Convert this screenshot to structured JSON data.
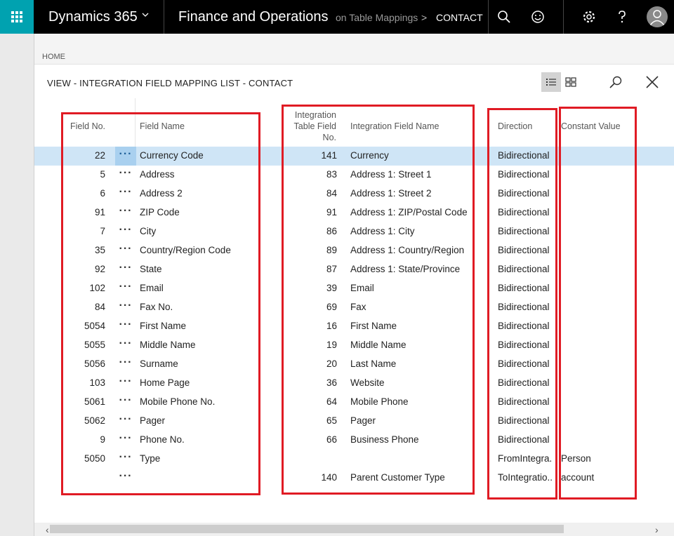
{
  "topbar": {
    "brand": "Dynamics 365",
    "app_name": "Finance and Operations",
    "breadcrumb_prev": "on Table Mappings",
    "breadcrumb_sep": ">",
    "breadcrumb_current": "CONTACT"
  },
  "home_label": "HOME",
  "page_title": "VIEW - INTEGRATION FIELD MAPPING LIST - CONTACT",
  "columns": {
    "field_no": "Field No.",
    "field_name": "Field Name",
    "int_field_no_1": "Integration",
    "int_field_no_2": "Table Field",
    "int_field_no_3": "No.",
    "int_field_name": "Integration Field Name",
    "direction": "Direction",
    "constant_value": "Constant Value"
  },
  "rows": [
    {
      "field_no": "22",
      "field_name": "Currency Code",
      "int_no": "141",
      "int_name": "Currency",
      "direction": "Bidirectional",
      "constant": ""
    },
    {
      "field_no": "5",
      "field_name": "Address",
      "int_no": "83",
      "int_name": "Address 1: Street 1",
      "direction": "Bidirectional",
      "constant": ""
    },
    {
      "field_no": "6",
      "field_name": "Address 2",
      "int_no": "84",
      "int_name": "Address 1: Street 2",
      "direction": "Bidirectional",
      "constant": ""
    },
    {
      "field_no": "91",
      "field_name": "ZIP Code",
      "int_no": "91",
      "int_name": "Address 1: ZIP/Postal Code",
      "direction": "Bidirectional",
      "constant": ""
    },
    {
      "field_no": "7",
      "field_name": "City",
      "int_no": "86",
      "int_name": "Address 1: City",
      "direction": "Bidirectional",
      "constant": ""
    },
    {
      "field_no": "35",
      "field_name": "Country/Region Code",
      "int_no": "89",
      "int_name": "Address 1: Country/Region",
      "direction": "Bidirectional",
      "constant": ""
    },
    {
      "field_no": "92",
      "field_name": "State",
      "int_no": "87",
      "int_name": "Address 1: State/Province",
      "direction": "Bidirectional",
      "constant": ""
    },
    {
      "field_no": "102",
      "field_name": "Email",
      "int_no": "39",
      "int_name": "Email",
      "direction": "Bidirectional",
      "constant": ""
    },
    {
      "field_no": "84",
      "field_name": "Fax No.",
      "int_no": "69",
      "int_name": "Fax",
      "direction": "Bidirectional",
      "constant": ""
    },
    {
      "field_no": "5054",
      "field_name": "First Name",
      "int_no": "16",
      "int_name": "First Name",
      "direction": "Bidirectional",
      "constant": ""
    },
    {
      "field_no": "5055",
      "field_name": "Middle Name",
      "int_no": "19",
      "int_name": "Middle Name",
      "direction": "Bidirectional",
      "constant": ""
    },
    {
      "field_no": "5056",
      "field_name": "Surname",
      "int_no": "20",
      "int_name": "Last Name",
      "direction": "Bidirectional",
      "constant": ""
    },
    {
      "field_no": "103",
      "field_name": "Home Page",
      "int_no": "36",
      "int_name": "Website",
      "direction": "Bidirectional",
      "constant": ""
    },
    {
      "field_no": "5061",
      "field_name": "Mobile Phone No.",
      "int_no": "64",
      "int_name": "Mobile Phone",
      "direction": "Bidirectional",
      "constant": ""
    },
    {
      "field_no": "5062",
      "field_name": "Pager",
      "int_no": "65",
      "int_name": "Pager",
      "direction": "Bidirectional",
      "constant": ""
    },
    {
      "field_no": "9",
      "field_name": "Phone No.",
      "int_no": "66",
      "int_name": "Business Phone",
      "direction": "Bidirectional",
      "constant": ""
    },
    {
      "field_no": "5050",
      "field_name": "Type",
      "int_no": "",
      "int_name": "",
      "direction": "FromIntegra...",
      "constant": "Person"
    },
    {
      "field_no": "",
      "field_name": "",
      "int_no": "140",
      "int_name": "Parent Customer Type",
      "direction": "ToIntegratio...",
      "constant": "account"
    }
  ],
  "icons": {
    "app_launcher": "waffle-icon",
    "search": "search-icon",
    "feedback": "smiley-icon",
    "settings": "gear-icon",
    "help": "help-icon",
    "user": "avatar-icon",
    "list_view": "list-view-icon",
    "grid_view": "grid-view-icon",
    "find": "find-icon",
    "close": "close-icon"
  },
  "colors": {
    "accent": "#00a2b0",
    "selection": "#cfe5f6",
    "annotation": "#e01b24"
  }
}
